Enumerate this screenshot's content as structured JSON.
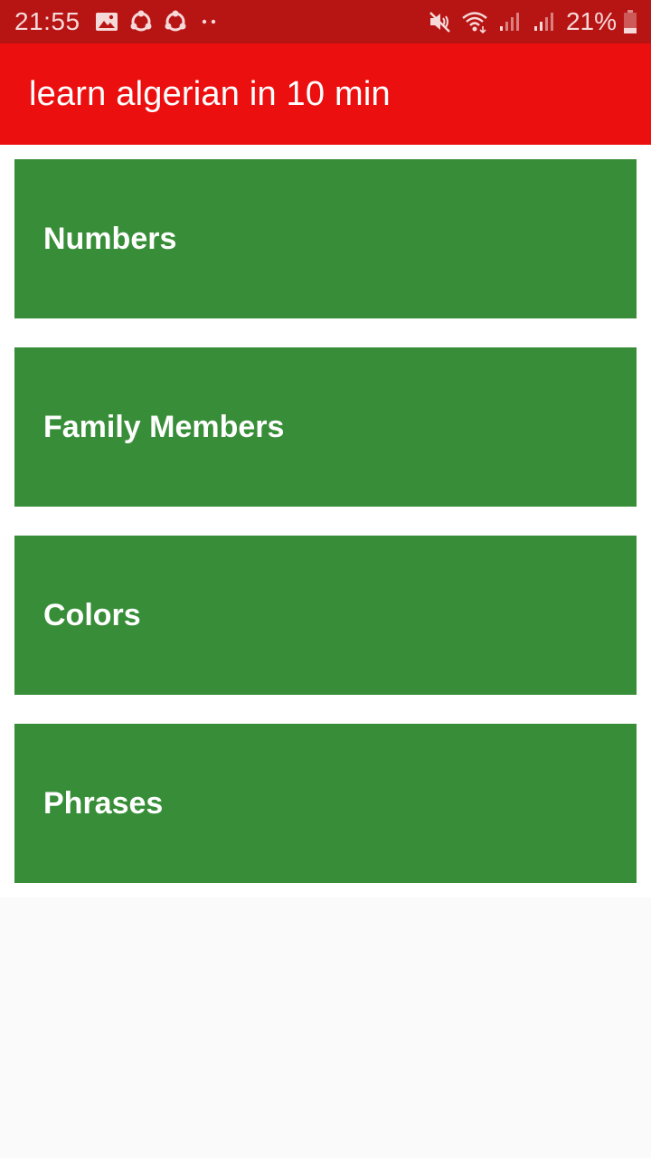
{
  "status_bar": {
    "time": "21:55",
    "battery": "21%",
    "left_icons": [
      "gallery-icon",
      "share-it-icon",
      "share-it-icon",
      "more-notifications-icon"
    ],
    "right_icons": [
      "mute-icon",
      "wifi-icon",
      "signal-icon",
      "signal-icon",
      "battery-icon"
    ]
  },
  "app_bar": {
    "title": "learn algerian in 10 min",
    "color": "#ec0f10"
  },
  "categories": [
    {
      "label": "Numbers"
    },
    {
      "label": "Family Members"
    },
    {
      "label": "Colors"
    },
    {
      "label": "Phrases"
    }
  ],
  "colors": {
    "status_bar": "#b71414",
    "card": "#388e38",
    "background": "#fafafa"
  }
}
